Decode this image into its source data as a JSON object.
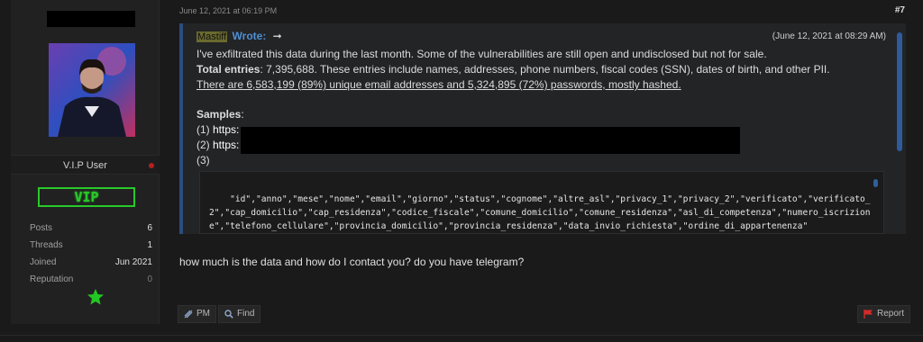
{
  "user": {
    "role": "V.I.P User",
    "badge": "VIP",
    "stats": [
      {
        "label": "Posts",
        "value": "6"
      },
      {
        "label": "Threads",
        "value": "1"
      },
      {
        "label": "Joined",
        "value": "Jun 2021"
      },
      {
        "label": "Reputation",
        "value": "0"
      }
    ]
  },
  "post": {
    "date": "June 12, 2021 at 06:19 PM",
    "number": "#7",
    "quote": {
      "author": "Mastiff",
      "wrote": "Wrote:",
      "arrow": "➞",
      "date": "(June 12, 2021 at 08:29 AM)",
      "line1": "I've exfiltrated this data during the last month. Some of the vulnerabilities are still open and undisclosed but not for sale.",
      "line2_bold": "Total entries",
      "line2_rest": ": 7,395,688. These entries include names, addresses, phone numbers, fiscal codes (SSN), dates of birth, and other PII.",
      "line3": "There are 6,583,199 (89%) unique email addresses and 5,324,895 (72%) passwords, mostly hashed.",
      "samples_label": "Samples",
      "samples_colon": ":",
      "sample1_prefix": "(1) ",
      "sample1_link": "https:",
      "sample2_prefix": "(2) ",
      "sample2_link": "https:",
      "sample3": "(3)",
      "code": "\"id\",\"anno\",\"mese\",\"nome\",\"email\",\"giorno\",\"status\",\"cognome\",\"altre_asl\",\"privacy_1\",\"privacy_2\",\"verificato\",\"verificato_2\",\"cap_domicilio\",\"cap_residenza\",\"codice_fiscale\",\"comune_domicilio\",\"comune_residenza\",\"asl_di_competenza\",\"numero_iscrizione\",\"telefono_cellulare\",\"provincia_domicilio\",\"provincia_residenza\",\"data_invio_richiesta\",\"ordine_di_appartenenza\""
    },
    "reply": "how much is the data and how do I contact you? do you have telegram?"
  },
  "buttons": {
    "pm": "PM",
    "find": "Find",
    "report": "Report"
  },
  "colors": {
    "badge_green": "#29c929",
    "link_blue": "#4f8fd6",
    "quote_border": "#2b4c7d",
    "report_red": "#d42a2a"
  }
}
